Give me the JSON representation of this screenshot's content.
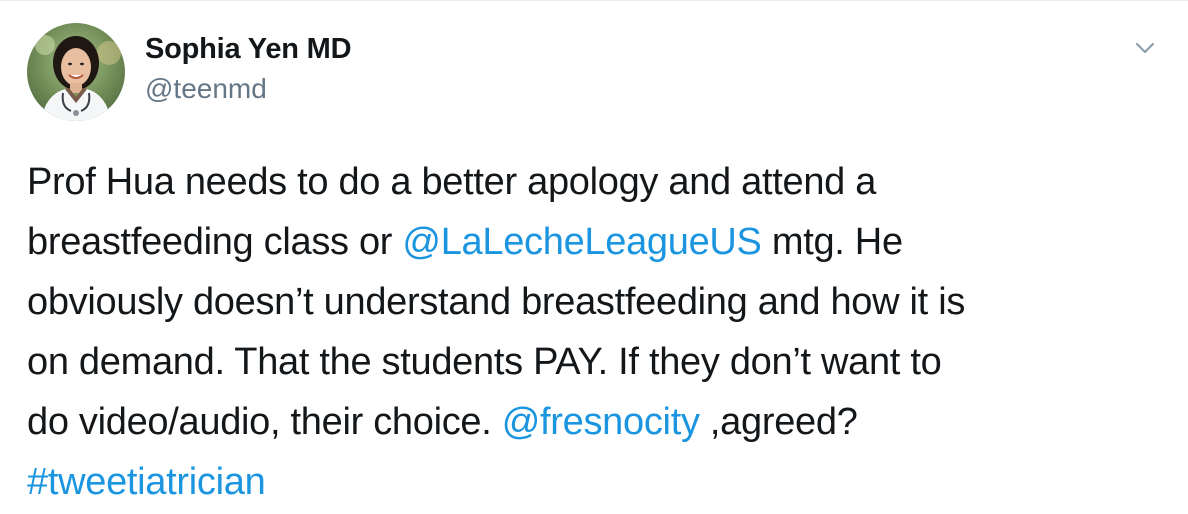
{
  "author": {
    "display_name": "Sophia Yen MD",
    "handle": "@teenmd"
  },
  "tweet": {
    "line1": "Prof Hua needs to do a better apology and attend a",
    "line2_pre": "breastfeeding class or ",
    "mention_lll": "@LaLecheLeagueUS",
    "line2_post": " mtg. He",
    "line3": "obviously doesn’t understand breastfeeding and how it is",
    "line4": "on demand. That the students PAY. If they don’t want to",
    "line5_pre": "do video/audio, their choice. ",
    "mention_fresno": "@fresnocity",
    "line5_post": " ,agreed?",
    "hashtag": "#tweetiatrician"
  },
  "icons": {
    "menu": "chevron-down-icon",
    "avatar": "profile-photo"
  },
  "colors": {
    "link": "#1b95e0",
    "text": "#14171a",
    "secondary": "#657786"
  }
}
